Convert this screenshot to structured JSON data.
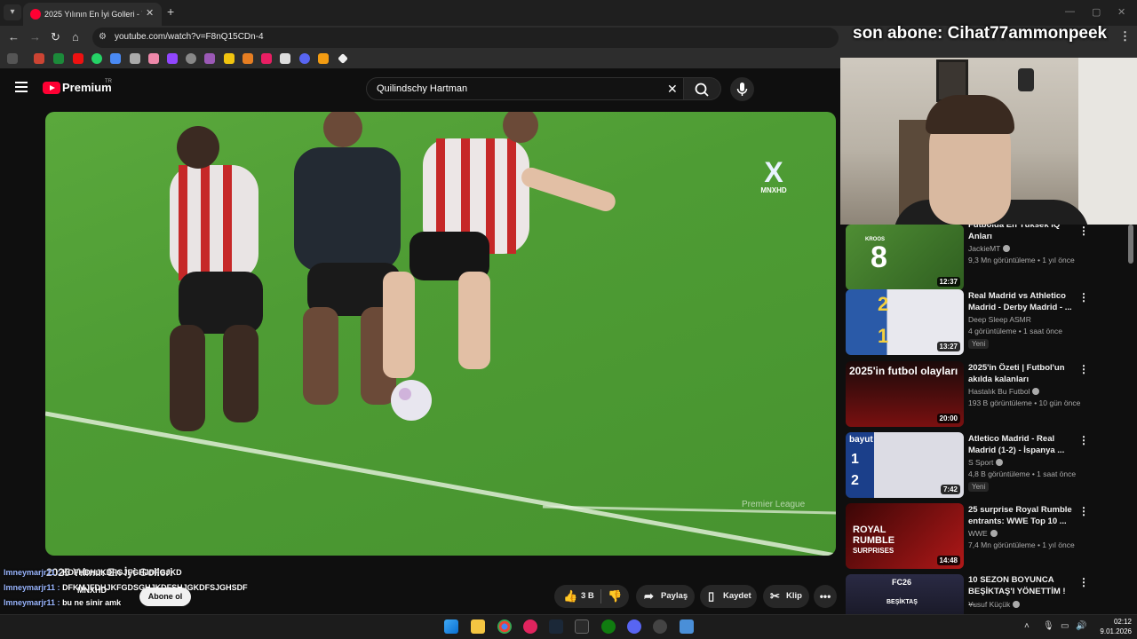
{
  "browser": {
    "tab_title": "2025 Yılının En İyi Golleri - YouT",
    "url": "youtube.com/watch?v=F8nQ15CDn-4"
  },
  "stream_overlay": {
    "last_subscriber": "son abone: Cihat77ammonpeek"
  },
  "youtube": {
    "brand": "Premium",
    "region": "TR",
    "search_query": "Quilindschy Hartman"
  },
  "video": {
    "channel_watermark": "MNXHD",
    "channel_watermark_x": "X",
    "broadcast_watermark": "Premier League",
    "title": "2025 Yılının En İyi Golleri",
    "channel": "MNXHD",
    "subscribe_label": "Abone ol",
    "likes": "3 B",
    "share_label": "Paylaş",
    "save_label": "Kaydet",
    "clip_label": "Klip"
  },
  "chat": [
    {
      "user": "lmneymarjr11 :",
      "message": "KDFHDHJKDFGJFGHJDFGJKD"
    },
    {
      "user": "lmneymarjr11 :",
      "message": "DFKMJFDHJKFGDSGHJKDFSHJGKDFSJGHSDF"
    },
    {
      "user": "lmneymarjr11 :",
      "message": "bu ne sinir amk"
    }
  ],
  "recommendations": [
    {
      "title": "Futbolda En Yüksek IQ Anları",
      "channel": "JackieMT",
      "meta": "9,3 Mn görüntüleme • 1 yıl önce",
      "duration": "12:37",
      "new": "",
      "thumb_color": "#3f7a2a"
    },
    {
      "title": "Real Madrid vs Athletico Madrid - Derby Madrid - ...",
      "channel": "Deep Sleep ASMR",
      "meta": "4 görüntüleme • 1 saat önce",
      "duration": "13:27",
      "new": "Yeni",
      "thumb_color": "#2a5aa8"
    },
    {
      "title": "2025'in Özeti | Futbol'un akılda kalanları",
      "channel": "Hastalık Bu Futbol",
      "meta": "193 B görüntüleme • 10 gün önce",
      "duration": "20:00",
      "new": "",
      "thumb_color": "#8a1b1b"
    },
    {
      "title": "Atletico Madrid - Real Madrid (1-2) - İspanya ...",
      "channel": "S Sport",
      "meta": "4,8 B görüntüleme • 1 saat önce",
      "duration": "7:42",
      "new": "Yeni",
      "thumb_color": "#1b3f8a"
    },
    {
      "title": "25 surprise Royal Rumble entrants: WWE Top 10 ...",
      "channel": "WWE",
      "meta": "7,4 Mn görüntüleme • 1 yıl önce",
      "duration": "14:48",
      "new": "",
      "thumb_color": "#9a1010"
    },
    {
      "title": "10 SEZON BOYUNCA BEŞİKTAŞ'I YÖNETTİM ! ...",
      "channel": "Yusuf Küçük",
      "meta": "",
      "duration": "",
      "new": "",
      "thumb_color": "#1a1a2e"
    }
  ],
  "thumb_texts": {
    "rec1_number": "8",
    "rec1_name": "KROOS",
    "rec2_score_top": "2",
    "rec2_score_bottom": "1",
    "rec3_headline": "2025'in futbol olayları",
    "rec4_brand": "bayut",
    "rec4_score_top": "1",
    "rec4_score_bottom": "2",
    "rec5_line1": "ROYAL",
    "rec5_line2": "RUMBLE",
    "rec5_line3": "SURPRISES",
    "rec6_brand": "FC26",
    "rec6_club": "BEŞİKTAŞ"
  },
  "taskbar": {
    "time": "02:12",
    "date": "9.01.2026"
  }
}
